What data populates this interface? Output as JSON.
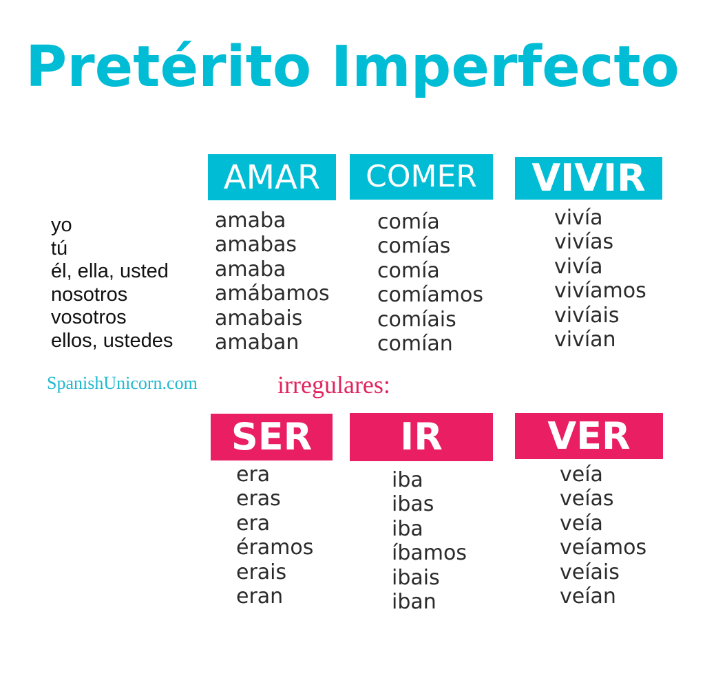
{
  "title": "Pretérito Imperfecto",
  "colors": {
    "accent_cyan": "#00bcd4",
    "accent_pink": "#e91e63",
    "text": "#2b2b2b"
  },
  "pronouns": [
    "yo",
    "tú",
    "él, ella, usted",
    "nosotros",
    "vosotros",
    "ellos, ustedes"
  ],
  "regular": [
    {
      "verb": "AMAR",
      "forms": [
        "amaba",
        "amabas",
        "amaba",
        "amábamos",
        "amabais",
        "amaban"
      ]
    },
    {
      "verb": "COMER",
      "forms": [
        "comía",
        "comías",
        "comía",
        "comíamos",
        "comíais",
        "comían"
      ]
    },
    {
      "verb": "VIVIR",
      "forms": [
        "vivía",
        "vivías",
        "vivía",
        "vivíamos",
        "vivíais",
        "vivían"
      ]
    }
  ],
  "site": "SpanishUnicorn.com",
  "irregular_label": "irregulares:",
  "irregular": [
    {
      "verb": "SER",
      "forms": [
        "era",
        "eras",
        "era",
        "éramos",
        "erais",
        "eran"
      ]
    },
    {
      "verb": "IR",
      "forms": [
        "iba",
        "ibas",
        "iba",
        "íbamos",
        "ibais",
        "iban"
      ]
    },
    {
      "verb": "VER",
      "forms": [
        "veía",
        "veías",
        "veía",
        "veíamos",
        "veíais",
        "veían"
      ]
    }
  ]
}
